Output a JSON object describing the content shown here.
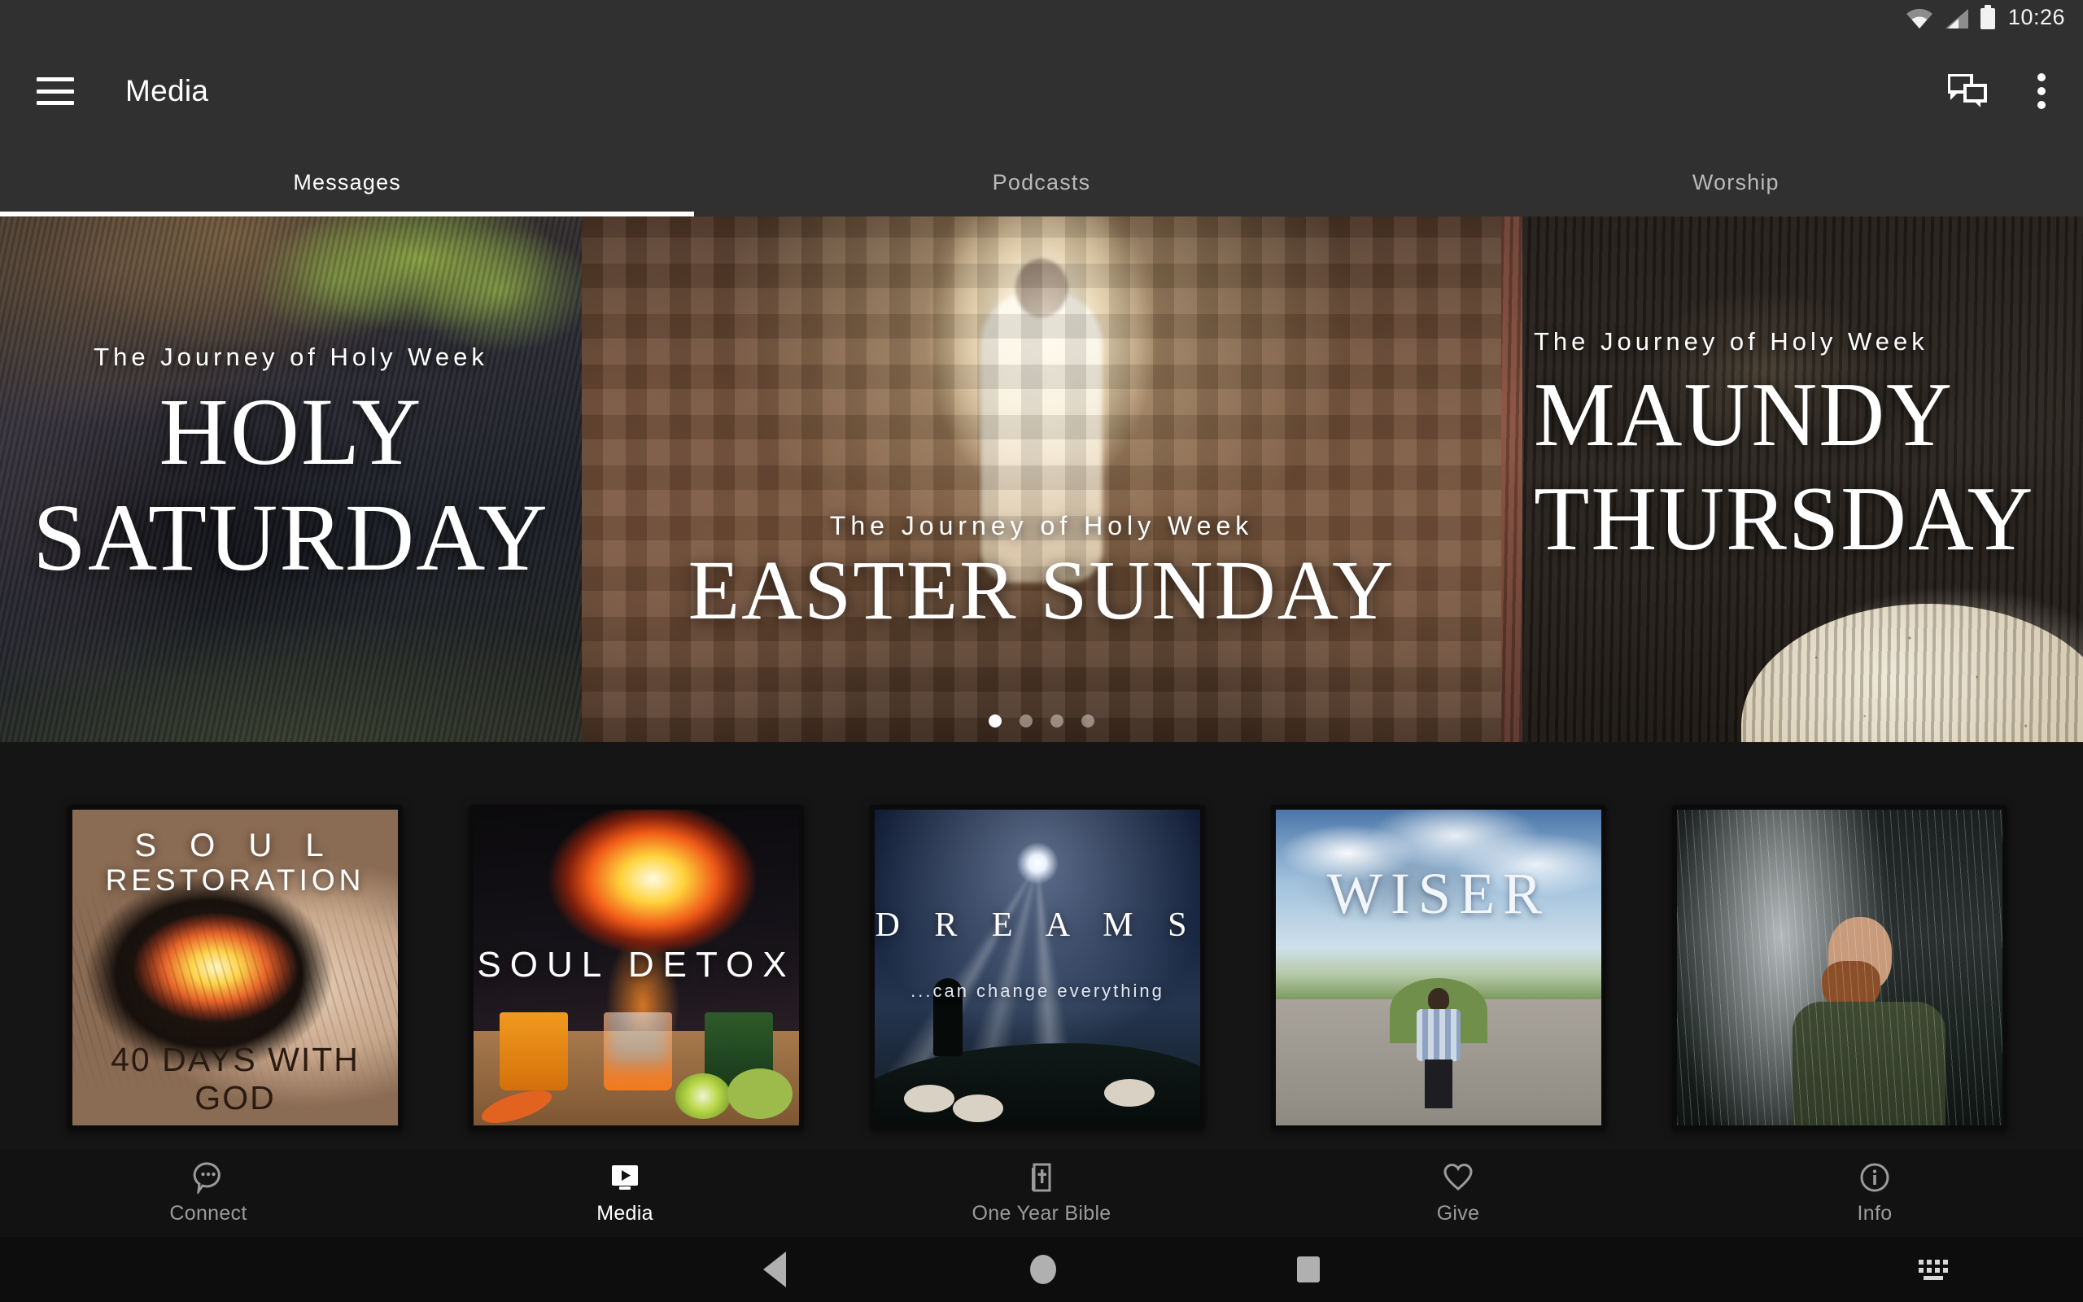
{
  "status_bar": {
    "time": "10:26",
    "icons": [
      "wifi-icon",
      "cellular-signal-icon",
      "battery-icon"
    ]
  },
  "app_bar": {
    "title": "Media",
    "menu_icon": "hamburger-menu-icon",
    "chat_icon": "forum-chat-icon",
    "overflow_icon": "more-vertical-icon"
  },
  "tabs": {
    "items": [
      {
        "label": "Messages",
        "active": true
      },
      {
        "label": "Podcasts",
        "active": false
      },
      {
        "label": "Worship",
        "active": false
      }
    ]
  },
  "hero_carousel": {
    "slides": [
      {
        "kicker": "The Journey of Holy Week",
        "title": "HOLY\nSATURDAY"
      },
      {
        "kicker": "The Journey of Holy Week",
        "title": "EASTER SUNDAY"
      },
      {
        "kicker": "The Journey of Holy Week",
        "title": "MAUNDY\nTHURSDAY"
      }
    ],
    "page_dots": 4,
    "active_dot": 1
  },
  "hero_text": {
    "s1_kicker": "The Journey of Holy Week",
    "s1_line1": "HOLY",
    "s1_line2": "SATURDAY",
    "s2_kicker": "The Journey of Holy Week",
    "s2_title": "EASTER SUNDAY",
    "s3_kicker": "The Journey of Holy Week",
    "s3_line1": "MAUNDY",
    "s3_line2": "THURSDAY"
  },
  "media_cards": [
    {
      "title_1": "S O U L",
      "title_2": "RESTORATION",
      "title_3": "40 DAYS WITH GOD"
    },
    {
      "title_1": "SOUL DETOX"
    },
    {
      "title_1": "D R E A M S",
      "title_2": "...can change everything"
    },
    {
      "title_1": "WISER"
    },
    {
      "title_1": ""
    }
  ],
  "cards_text": {
    "soul_1": "S O U L",
    "soul_2": "RESTORATION",
    "soul_3": "40 DAYS WITH GOD",
    "detox": "SOUL DETOX",
    "dreams_1": "D R E A M S",
    "dreams_2": "...can change everything",
    "wiser": "WISER"
  },
  "bottom_nav": {
    "items": [
      {
        "label": "Connect",
        "icon": "chat-bubble-dots-icon",
        "active": false
      },
      {
        "label": "Media",
        "icon": "tv-play-icon",
        "active": true
      },
      {
        "label": "One Year Bible",
        "icon": "bible-book-icon",
        "active": false
      },
      {
        "label": "Give",
        "icon": "heart-icon",
        "active": false
      },
      {
        "label": "Info",
        "icon": "info-circle-icon",
        "active": false
      }
    ]
  },
  "bottom_nav_labels": {
    "connect": "Connect",
    "media": "Media",
    "bible": "One Year Bible",
    "give": "Give",
    "info": "Info"
  },
  "system_nav": {
    "back_icon": "back-triangle-icon",
    "home_icon": "home-circle-icon",
    "recents_icon": "recents-square-icon",
    "keyboard_icon": "keyboard-icon"
  },
  "colors": {
    "appbar_bg": "#303030",
    "content_bg": "#151515",
    "bottomnav_bg": "#121212",
    "sysnav_bg": "#0d0d0d",
    "accent": "#ffffff",
    "inactive_text": "#9b9b9b"
  }
}
